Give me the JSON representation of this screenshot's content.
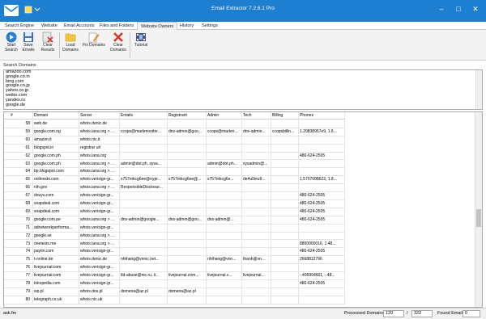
{
  "window": {
    "title": "Email Extractor 7.2.6.1 Pro",
    "minimize": "–",
    "maximize": "□",
    "close": "✕"
  },
  "tabs": [
    {
      "label": "Search Engine"
    },
    {
      "label": "Website"
    },
    {
      "label": "Email Accounts"
    },
    {
      "label": "Files and Folders"
    },
    {
      "label": "Website Owners",
      "active": true
    },
    {
      "label": "History"
    },
    {
      "label": "Settings"
    }
  ],
  "ribbon": {
    "start_search": "Start\nSearch",
    "save_emails": "Save\nEmails",
    "clear_results": "Clear\nResults",
    "load_domains": "Load\nDomains",
    "fix_domains": "Fix Domains",
    "clear_domains": "Clear\nDomains",
    "tutorial": "Tutorial"
  },
  "search_domains": {
    "label": "Search Domains",
    "lines": [
      "amazon.com",
      "google.co.in",
      "bing.com",
      "google.co.jp",
      "yahoo.co.jp",
      "weibo.com",
      "yandex.ru",
      "google.de"
    ]
  },
  "grid": {
    "columns": [
      "#",
      "Domain",
      "Server",
      "Emails",
      "Registrant",
      "Admin",
      "Tech",
      "Billing",
      "Phones"
    ],
    "rows": [
      [
        "58",
        "web.de",
        "whois.denic.de",
        "",
        "",
        "",
        "",
        "",
        ""
      ],
      [
        "59",
        "google.com.ng",
        "whois.iana.org > ...",
        "ccops@markmonitor...",
        "dns-admin@goo...",
        "ccops@markm...",
        "dns-admin...",
        "ccopsbillin...",
        "1.20838957e9, 1.6..."
      ],
      [
        "60",
        "amazon.it",
        "whois.nic.it",
        "",
        "",
        "",
        "",
        "",
        ""
      ],
      [
        "61",
        "blogspot.in",
        "registrar url",
        "",
        "",
        "",
        "",
        "",
        ""
      ],
      [
        "62",
        "google.com.ph",
        "whois.iana.org",
        "",
        "",
        "",
        "",
        "",
        "480-624-2505"
      ],
      [
        "63",
        "google.com.ph",
        "whois.iana.org > ...",
        "admin@dot.ph, sysa...",
        "",
        "admin@dot.ph...",
        "sysadmin@...",
        "",
        ""
      ],
      [
        "64",
        "bp.blogspot.com",
        "whois.iana.org > ...",
        "",
        "",
        "",
        "",
        "",
        ""
      ],
      [
        "65",
        "onlinesbi.com",
        "whois.verisign-gr...",
        "s757mkcg6ee@nypr...",
        "s757mkcg6ee@...",
        "s757mkcg6e...",
        "de4u5leu9...",
        "",
        "1.5707088622, 1.8..."
      ],
      [
        "66",
        "nih.gov",
        "whois.iana.org > ...",
        "ResponsibleDisclosur...",
        "",
        "",
        "",
        "",
        ""
      ],
      [
        "67",
        "douyu.com",
        "whois.verisign-gr...",
        "",
        "",
        "",
        "",
        "",
        "480-624-2505"
      ],
      [
        "68",
        "snapdeal.com",
        "whois.verisign-gr...",
        "",
        "",
        "",
        "",
        "",
        "480-624-2505"
      ],
      [
        "69",
        "snapdeal.com",
        "whois.verisign-gr...",
        "",
        "",
        "",
        "",
        "",
        "480-624-2505"
      ],
      [
        "70",
        "google.com.pe",
        "whois.iana.org > ...",
        "dns-admin@google...",
        "dns-admin@goo...",
        "dns-admin@...",
        "",
        "",
        "480-624-2505"
      ],
      [
        "71",
        "adnetworkperforma...",
        "whois.verisign-gr...",
        "",
        "",
        "",
        "",
        "",
        ""
      ],
      [
        "72",
        "google.se",
        "whois.iana.org > ...",
        "",
        "",
        "",
        "",
        "",
        ""
      ],
      [
        "73",
        "onetests.me",
        "whois.iana.org > ...",
        "",
        "",
        "",
        "",
        "",
        "8850000016, 1.48..."
      ],
      [
        "74",
        "paytm.com",
        "whois.verisign-gr...",
        "",
        "",
        "",
        "",
        "",
        "480-624-2505"
      ],
      [
        "75",
        "t-online.de",
        "whois.denic.de",
        "nhthang@vnnic.net...",
        "",
        "nhthang@vnn...",
        "thanh@vn...",
        "",
        "2668812796"
      ],
      [
        "76",
        "livejournal.com",
        "whois.verisign-gr...",
        "",
        "",
        "",
        "",
        "",
        ""
      ],
      [
        "77",
        "livejournal.com",
        "whois.verisign-gr...",
        "tld-abuse@nic.ru, li...",
        "livejournal.com...",
        "livejournal.c...",
        "livejournal...",
        "",
        "-.495994601, -.48..."
      ],
      [
        "78",
        "tokopedia.com",
        "whois.verisign-gr...",
        "",
        "",
        "",
        "",
        "",
        "480-624-2505"
      ],
      [
        "79",
        "wp.pl",
        "whois.dns.pl",
        "domena@az.pl",
        "domena@az.pl",
        "",
        "",
        "",
        ""
      ],
      [
        "80",
        "telegraph.co.uk",
        "whois.nic.uk",
        "",
        "",
        "",
        "",
        "",
        ""
      ]
    ]
  },
  "status": {
    "current_domain": "ask.fm",
    "processed_label": "Processed Domains",
    "processed_value": "120",
    "separator": "/",
    "total_value": "322",
    "found_label": "Found Emails",
    "found_value": "0"
  }
}
